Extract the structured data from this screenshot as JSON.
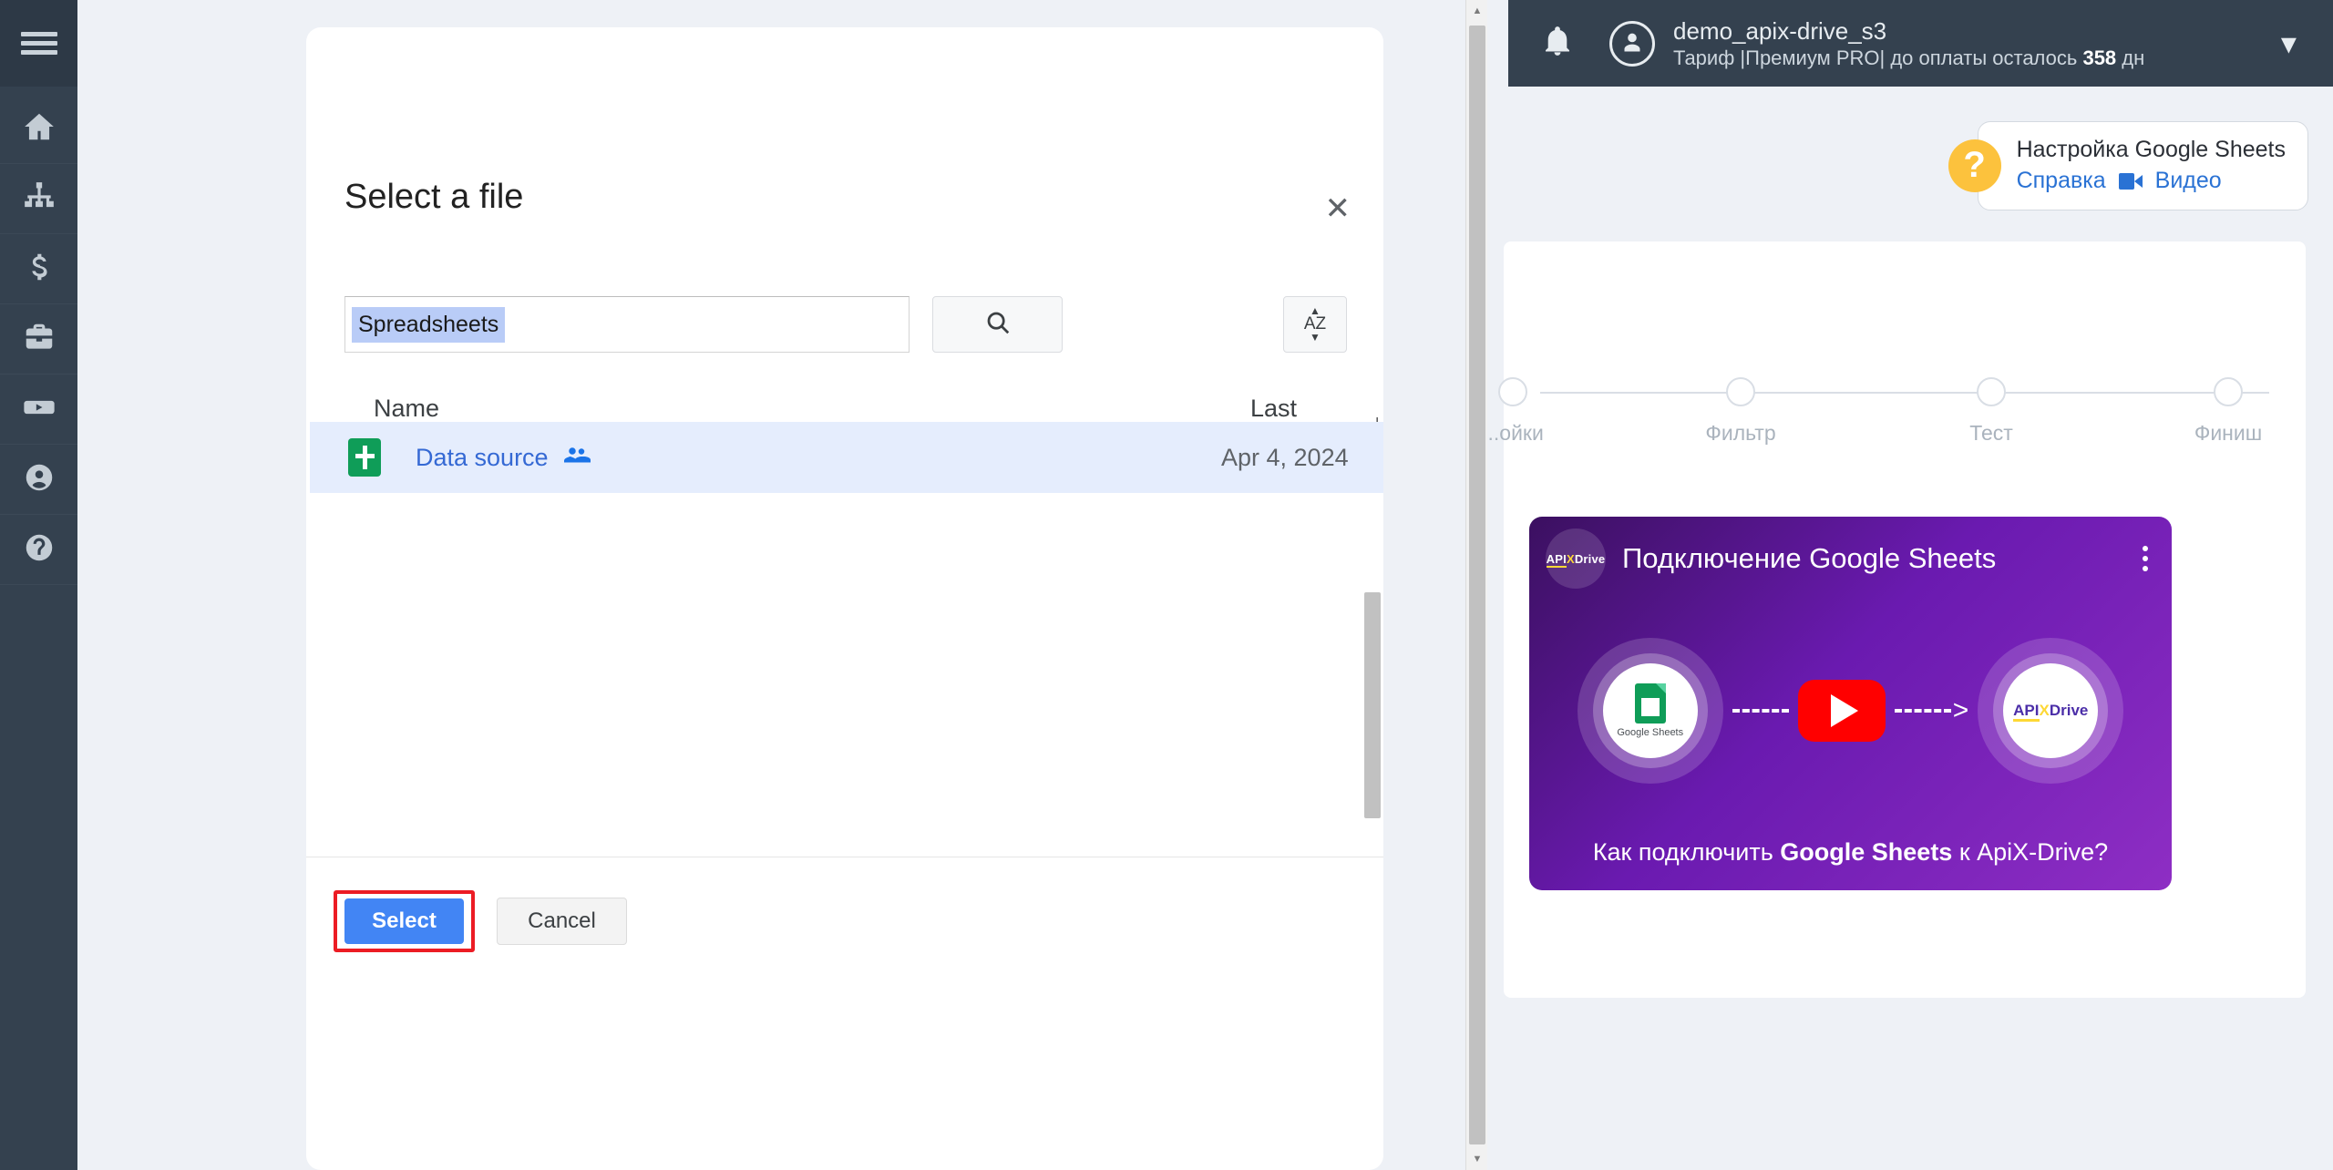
{
  "sidebar": {
    "menu_icon": "hamburger-icon",
    "items": [
      {
        "icon": "home-icon",
        "name": "home"
      },
      {
        "icon": "sitemap-icon",
        "name": "connections"
      },
      {
        "icon": "dollar-icon",
        "name": "billing"
      },
      {
        "icon": "briefcase-icon",
        "name": "business"
      },
      {
        "icon": "youtube-icon",
        "name": "video"
      },
      {
        "icon": "user-icon",
        "name": "account"
      },
      {
        "icon": "question-icon",
        "name": "help"
      }
    ]
  },
  "topbar": {
    "bell_icon": "bell-icon",
    "avatar_icon": "user-avatar-icon",
    "account_name": "demo_apix-drive_s3",
    "plan_prefix": "Тариф |Премиум PRO| до оплаты осталось ",
    "plan_days": "358",
    "plan_suffix": " дн",
    "chevron": "▾"
  },
  "help": {
    "badge": "?",
    "title": "Настройка Google Sheets",
    "link_help": "Справка",
    "link_video": "Видео",
    "video_icon": "video-camera-icon"
  },
  "steps": [
    {
      "label": "...ойки"
    },
    {
      "label": "Фильтр"
    },
    {
      "label": "Тест"
    },
    {
      "label": "Финиш"
    }
  ],
  "video": {
    "logo_api": "API",
    "logo_x": "X",
    "logo_drive": "Drive",
    "title": "Подключение Google Sheets",
    "menu_icon": "kebab-menu-icon",
    "left_app_label": "Google Sheets",
    "play_icon": "play-button-icon",
    "caption_before": "Как подключить ",
    "caption_bold": "Google Sheets",
    "caption_after": " к ApiX-Drive?"
  },
  "modal": {
    "title": "Select a file",
    "close_icon": "✕",
    "search": {
      "value": "Spreadsheets",
      "placeholder": "",
      "search_icon": "search-icon",
      "sort_icon": "sort-az-icon",
      "sort_a": "A",
      "sort_z": "Z",
      "sort_up": "▲",
      "sort_down": "▼"
    },
    "columns": {
      "name": "Name",
      "last_modified": "Last modified",
      "sort_arrow": "↓"
    },
    "rows": [
      {
        "file_icon": "google-sheets-icon",
        "name": "Data source",
        "shared_icon": "people-shared-icon",
        "last_modified": "Apr 4, 2024"
      }
    ],
    "buttons": {
      "select": "Select",
      "cancel": "Cancel"
    }
  },
  "colors": {
    "accent_blue": "#4285f4",
    "sheets_green": "#0f9d58",
    "highlight_red": "#ec1c24",
    "sidebar_dark": "#34414f",
    "row_selected": "#e5edfd"
  }
}
